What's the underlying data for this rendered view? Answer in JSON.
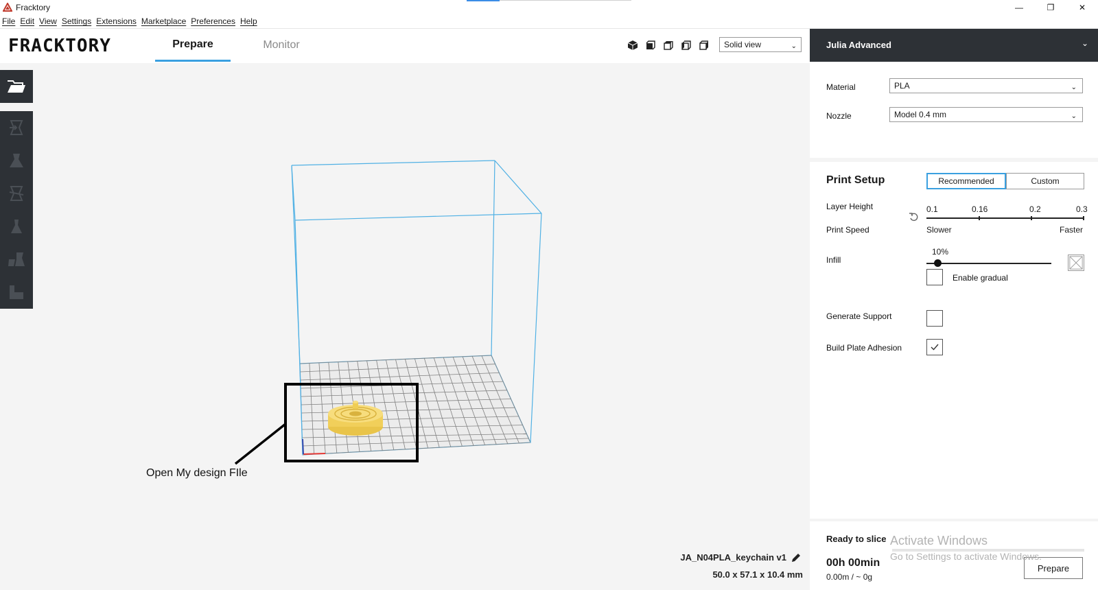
{
  "window": {
    "title": "Fracktory",
    "min_label": "—",
    "restore_label": "❐",
    "close_label": "✕"
  },
  "menu": [
    "File",
    "Edit",
    "View",
    "Settings",
    "Extensions",
    "Marketplace",
    "Preferences",
    "Help"
  ],
  "header": {
    "logo": "FRACKTORY",
    "tabs": [
      {
        "label": "Prepare",
        "active": true
      },
      {
        "label": "Monitor",
        "active": false
      }
    ],
    "view_icons": [
      "3d-view-icon",
      "front-view-icon",
      "top-view-icon",
      "left-view-icon",
      "right-view-icon"
    ],
    "view_mode": "Solid view"
  },
  "toolbar": {
    "open_icon": "folder-open-icon",
    "tools": [
      "move-tool-icon",
      "scale-tool-icon",
      "rotate-tool-icon",
      "mirror-tool-icon",
      "per-model-settings-icon",
      "support-blocker-icon"
    ]
  },
  "viewport": {
    "annotation": "Open My design FIle",
    "model_name": "JA_N04PLA_keychain   v1",
    "model_dims": "50.0 x 57.1 x 10.4 mm"
  },
  "printer": {
    "name": "Julia Advanced",
    "material_label": "Material",
    "material": "PLA",
    "nozzle_label": "Nozzle",
    "nozzle": "Model 0.4 mm"
  },
  "print_setup": {
    "title": "Print Setup",
    "mode_recommended": "Recommended",
    "mode_custom": "Custom",
    "layer_height_label": "Layer Height",
    "layer_height_ticks": [
      "0.1",
      "0.16",
      "0.2",
      "0.3"
    ],
    "print_speed_label": "Print Speed",
    "speed_slower": "Slower",
    "speed_faster": "Faster",
    "infill_label": "Infill",
    "infill_value": "10%",
    "gradual_label": "Enable gradual",
    "support_label": "Generate Support",
    "support_checked": false,
    "adhesion_label": "Build Plate Adhesion",
    "adhesion_checked": true,
    "gradual_checked": false
  },
  "slice": {
    "status": "Ready to slice",
    "time": "00h 00min",
    "usage": "0.00m / ~ 0g",
    "button": "Prepare"
  },
  "watermark": {
    "line1": "Activate Windows",
    "line2": "Go to Settings to activate Windows."
  },
  "colors": {
    "accent": "#3aa0e0",
    "dark": "#2d3136",
    "model": "#f5d76e"
  }
}
